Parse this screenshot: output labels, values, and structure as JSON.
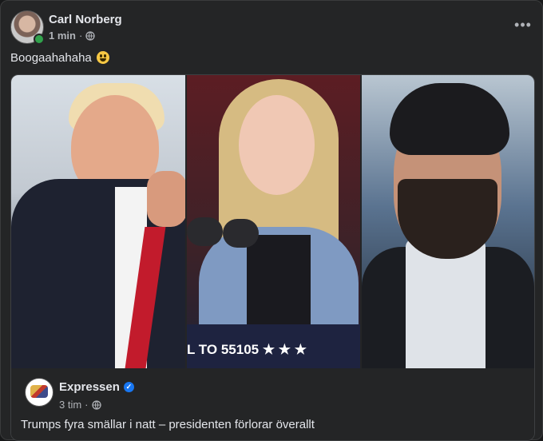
{
  "post": {
    "author": "Carl Norberg",
    "time": "1 min",
    "separator": "·",
    "text": "Boogaahahaha",
    "more_label": "•••"
  },
  "shared_card": {
    "banner_text": "L TO 55105  ★  ★  ★",
    "source_name": "Expressen",
    "source_time": "3 tim",
    "separator": "·",
    "headline": "Trumps fyra smällar i natt – presidenten förlorar överallt"
  },
  "icons": {
    "globe": "globe-icon",
    "verified": "verified-badge-icon",
    "more": "more-options-icon",
    "emoji": "grinning-face-emoji"
  },
  "colors": {
    "background": "#242526",
    "online": "#31a24c",
    "verified": "#1877f2"
  }
}
